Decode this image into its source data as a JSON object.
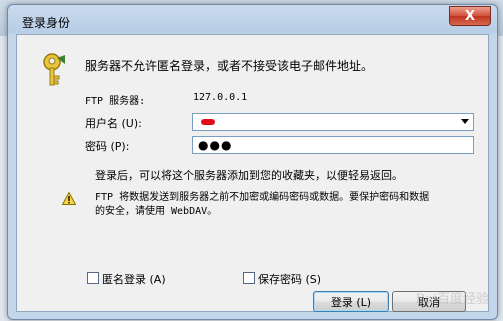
{
  "dialog": {
    "title": "登录身份",
    "close_label": "X",
    "intro": "服务器不允许匿名登录，或者不接受该电子邮件地址。",
    "server_label": "FTP 服务器:",
    "server_value": "127.0.0.1",
    "username_label": "用户名 (U):",
    "username_value": "",
    "password_label": "密码 (P):",
    "password_value": "●●●",
    "save_note": "登录后，可以将这个服务器添加到您的收藏夹，以便轻易返回。",
    "warning_line1": "FTP 将数据发送到服务器之前不加密或编码密码或数据。要保护密码和数据",
    "warning_line2": "的安全，请使用 WebDAV。",
    "anonymous_label": "匿名登录 (A)",
    "save_password_label": "保存密码 (S)",
    "login_button": "登录 (L)",
    "cancel_button": "取消"
  },
  "icons": {
    "dialog_icon": "key-icon",
    "warning": "warning-icon"
  },
  "colors": {
    "username_redaction": "#e0101a",
    "warning": "#f6d743"
  },
  "watermark": "Bai百度经验"
}
